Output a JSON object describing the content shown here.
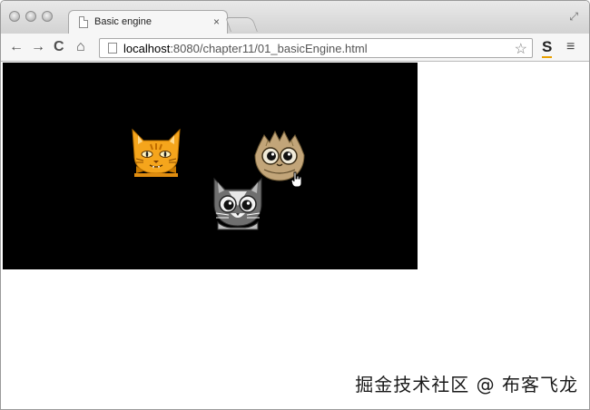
{
  "browser": {
    "tab": {
      "title": "Basic engine",
      "close_glyph": "×"
    },
    "toolbar": {
      "back_glyph": "←",
      "forward_glyph": "→",
      "reload_glyph": "C",
      "home_glyph": "⌂",
      "url_host": "localhost",
      "url_path": ":8080/chapter11/01_basicEngine.html",
      "bookmark_glyph": "☆",
      "extension_glyph": "S",
      "menu_glyph": "≡"
    },
    "fullscreen_glyph": "⤢"
  },
  "page": {
    "canvas": {
      "background": "#000000",
      "sprites": [
        {
          "name": "orange-cat-sprite",
          "color": "#f5a51c"
        },
        {
          "name": "owl-creature-sprite",
          "color": "#c2a579"
        },
        {
          "name": "gray-cat-sprite",
          "color": "#7a7a7a"
        }
      ]
    }
  },
  "watermark": "掘金技术社区 @ 布客飞龙",
  "icons": [
    "close-dot-icon",
    "page-icon",
    "back-arrow-icon",
    "forward-arrow-icon",
    "reload-icon",
    "home-icon",
    "star-icon",
    "extension-icon",
    "menu-icon",
    "fullscreen-icon",
    "hand-cursor-icon"
  ]
}
